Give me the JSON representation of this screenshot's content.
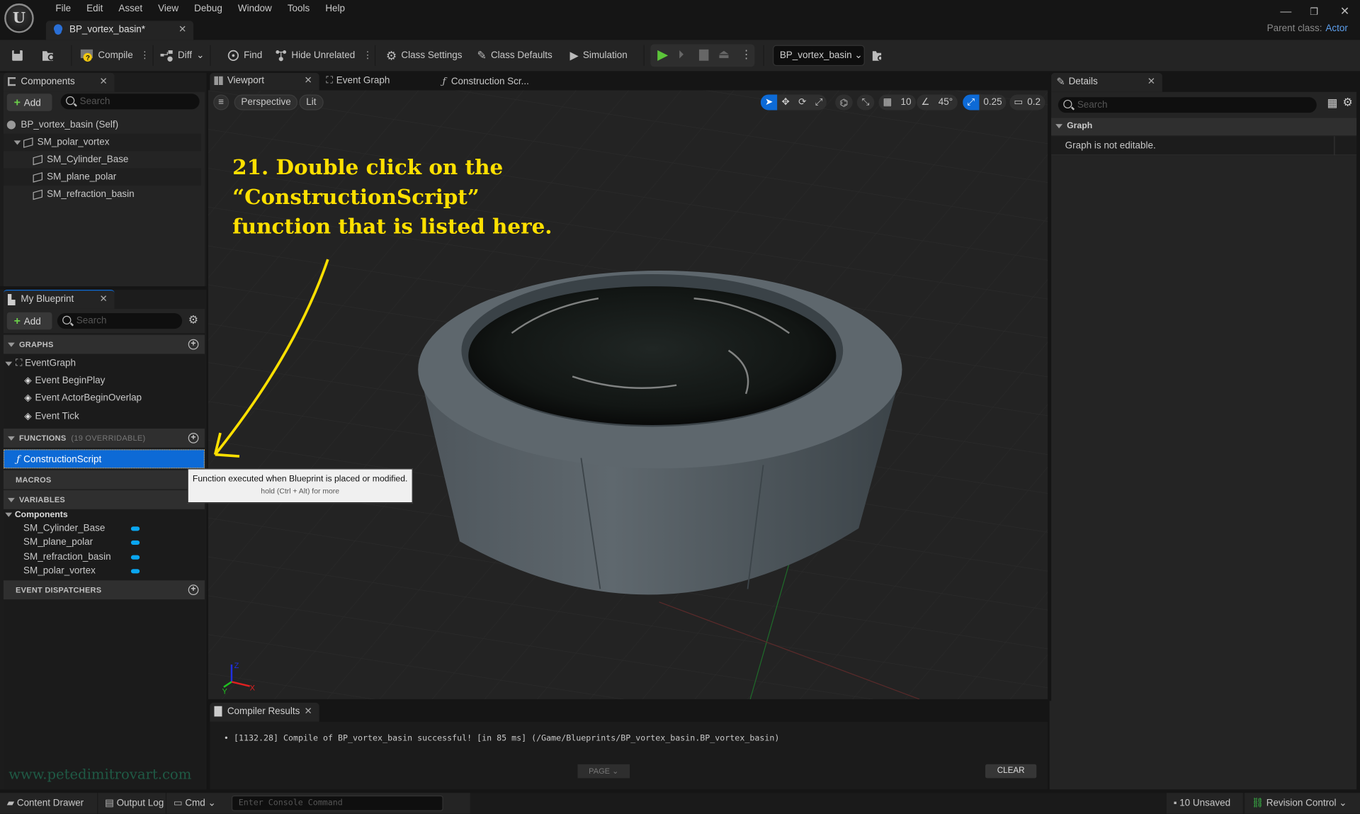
{
  "app": {
    "menu": [
      "File",
      "Edit",
      "Asset",
      "View",
      "Debug",
      "Window",
      "Tools",
      "Help"
    ],
    "document_tab": "BP_vortex_basin*",
    "parent_class_label": "Parent class:",
    "parent_class_value": "Actor",
    "window_controls": {
      "minimize": "—",
      "restore": "❐",
      "close": "✕"
    }
  },
  "toolbar": {
    "compile": "Compile",
    "diff": "Diff",
    "find": "Find",
    "hide_unrelated": "Hide Unrelated",
    "class_settings": "Class Settings",
    "class_defaults": "Class Defaults",
    "simulation": "Simulation",
    "debug_object": "BP_vortex_basin",
    "accent_play": "#5cc53a"
  },
  "components_panel": {
    "title": "Components",
    "add_label": "Add",
    "search_placeholder": "Search",
    "tree": [
      {
        "label": "BP_vortex_basin (Self)",
        "level": 0
      },
      {
        "label": "SM_polar_vortex",
        "level": 1
      },
      {
        "label": "SM_Cylinder_Base",
        "level": 2
      },
      {
        "label": "SM_plane_polar",
        "level": 2
      },
      {
        "label": "SM_refraction_basin",
        "level": 2
      }
    ]
  },
  "my_blueprint": {
    "title": "My Blueprint",
    "add_label": "Add",
    "search_placeholder": "Search",
    "graphs_header": "GRAPHS",
    "event_graph": "EventGraph",
    "events": [
      "Event BeginPlay",
      "Event ActorBeginOverlap",
      "Event Tick"
    ],
    "functions_header": "FUNCTIONS",
    "functions_note": "(19 OVERRIDABLE)",
    "selected_function": "ConstructionScript",
    "macros_header": "MACROS",
    "variables_header": "VARIABLES",
    "variables_group": "Components",
    "variables": [
      "SM_Cylinder_Base",
      "SM_plane_polar",
      "SM_refraction_basin",
      "SM_polar_vortex"
    ],
    "variable_color": "#0aa6f0",
    "dispatchers_header": "EVENT DISPATCHERS"
  },
  "tooltip": {
    "text": "Function executed when Blueprint is placed or modified.",
    "hint": "hold (Ctrl + Alt) for more"
  },
  "editor_tabs": [
    "Viewport",
    "Event Graph",
    "Construction Scr..."
  ],
  "viewport": {
    "perspective": "Perspective",
    "lit": "Lit",
    "grid_snap": "10",
    "rotation_snap": "45°",
    "scale_snap": "0.25",
    "camera_speed": "0.2",
    "annotation": [
      "21. Double click on the",
      "“ConstructionScript”",
      "function that is listed here."
    ],
    "annotation_color": "#ffe000",
    "axes": {
      "x": "X",
      "y": "Y",
      "z": "Z"
    }
  },
  "details_panel": {
    "title": "Details",
    "search_placeholder": "Search",
    "section": "Graph",
    "message": "Graph is not editable."
  },
  "compiler_results": {
    "title": "Compiler Results",
    "message": "[1132.28] Compile of BP_vortex_basin successful! [in 85 ms] (/Game/Blueprints/BP_vortex_basin.BP_vortex_basin)",
    "page_label": "PAGE",
    "clear_label": "CLEAR"
  },
  "watermark": "www.petedimitrovart.com",
  "status_bar": {
    "content_drawer": "Content Drawer",
    "output_log": "Output Log",
    "cmd": "Cmd",
    "console_placeholder": "Enter Console Command",
    "unsaved": "10 Unsaved",
    "revision_control": "Revision Control"
  }
}
